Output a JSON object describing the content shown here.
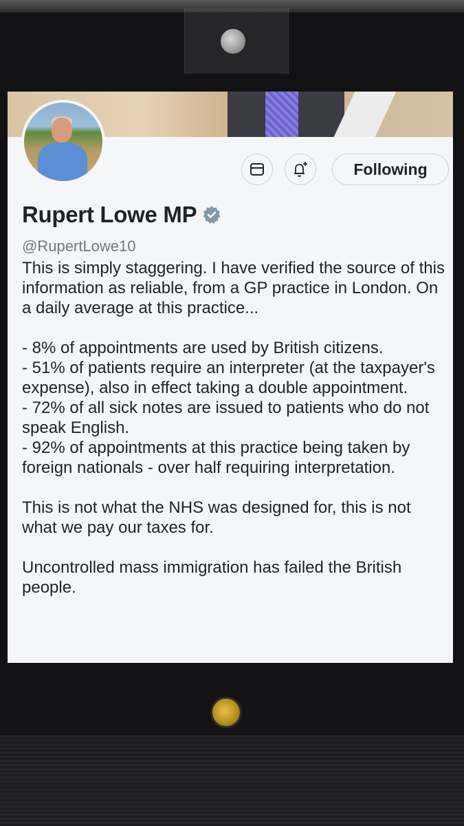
{
  "profile": {
    "display_name": "Rupert Lowe MP",
    "handle": "@RupertLowe10",
    "verified": true,
    "verified_badge_icon": "verified-badge-icon"
  },
  "actions": {
    "message_icon": "envelope-icon",
    "notify_icon": "bell-plus-icon",
    "following_label": "Following"
  },
  "post": {
    "paragraphs": [
      "This is simply staggering. I have verified the source of this information as reliable, from a GP practice in London. On a daily average at this practice...",
      "- 8% of appointments are used by British citizens.",
      "- 51% of patients require an interpreter (at the taxpayer's expense), also in effect taking a double appointment.",
      "- 72% of all sick notes are issued to patients who do not speak English.",
      "- 92% of appointments at this practice being taken by foreign nationals - over half requiring interpretation.",
      "This is not what the NHS was designed for, this is not what we pay our taxes for.",
      "Uncontrolled mass immigration has failed the British people."
    ]
  },
  "colors": {
    "text": "#1f2328",
    "handle": "#6e7880",
    "verified": "#7f9aab",
    "screen_bg": "#f4f6f8"
  }
}
